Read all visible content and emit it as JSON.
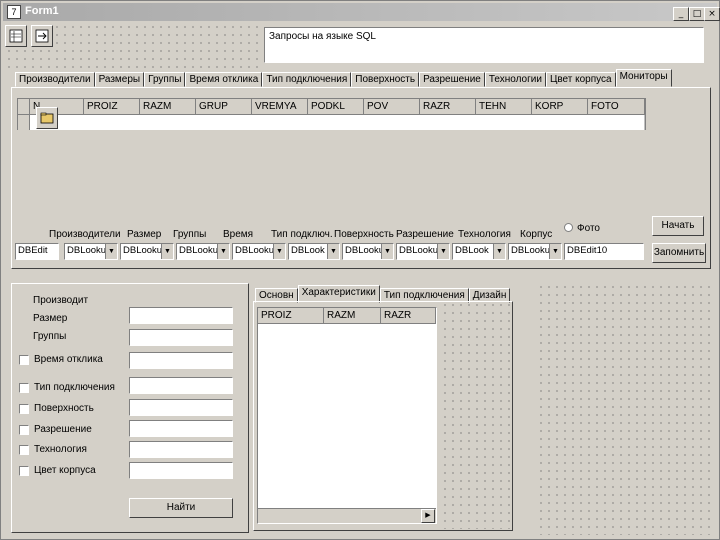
{
  "window": {
    "title": "Form1",
    "min": "_",
    "max": "□",
    "close": "×"
  },
  "sql_memo": {
    "text": "Запросы на языке SQL"
  },
  "top_tabs": [
    "Производители",
    "Размеры",
    "Группы",
    "Время отклика",
    "Тип подключения",
    "Поверхность",
    "Разрешение",
    "Технологии",
    "Цвет корпуса",
    "Мониторы"
  ],
  "grid": {
    "columns": [
      "N",
      "PROIZ",
      "RAZM",
      "GRUP",
      "VREMYA",
      "PODKL",
      "POV",
      "RAZR",
      "TEHN",
      "KORP",
      "FOTO"
    ]
  },
  "field_labels": [
    "Производители",
    "Размер",
    "Группы",
    "Время",
    "Тип подключ.",
    "Поверхность",
    "Разрешение",
    "Технология",
    "Корпус",
    "Фото"
  ],
  "lookups": [
    "DBEdit",
    "DBLookup",
    "DBLooku",
    "DBLooku",
    "DBLooku",
    "DBLook",
    "DBLooku",
    "DBLooku",
    "DBLook",
    "DBLooku",
    "DBEdit10"
  ],
  "buttons": {
    "start": "Начать",
    "save": "Запомнить",
    "find": "Найти"
  },
  "search": {
    "labels": [
      "Производит",
      "Размер",
      "Группы",
      "Время отклика",
      "Тип подключения",
      "Поверхность",
      "Разрешение",
      "Технология",
      "Цвет корпуса"
    ]
  },
  "bottom_tabs": [
    "Основн",
    "Характеристики",
    "Тип подключения",
    "Дизайн"
  ],
  "bottom_grid": {
    "columns": [
      "PROIZ",
      "RAZM",
      "RAZR"
    ]
  }
}
